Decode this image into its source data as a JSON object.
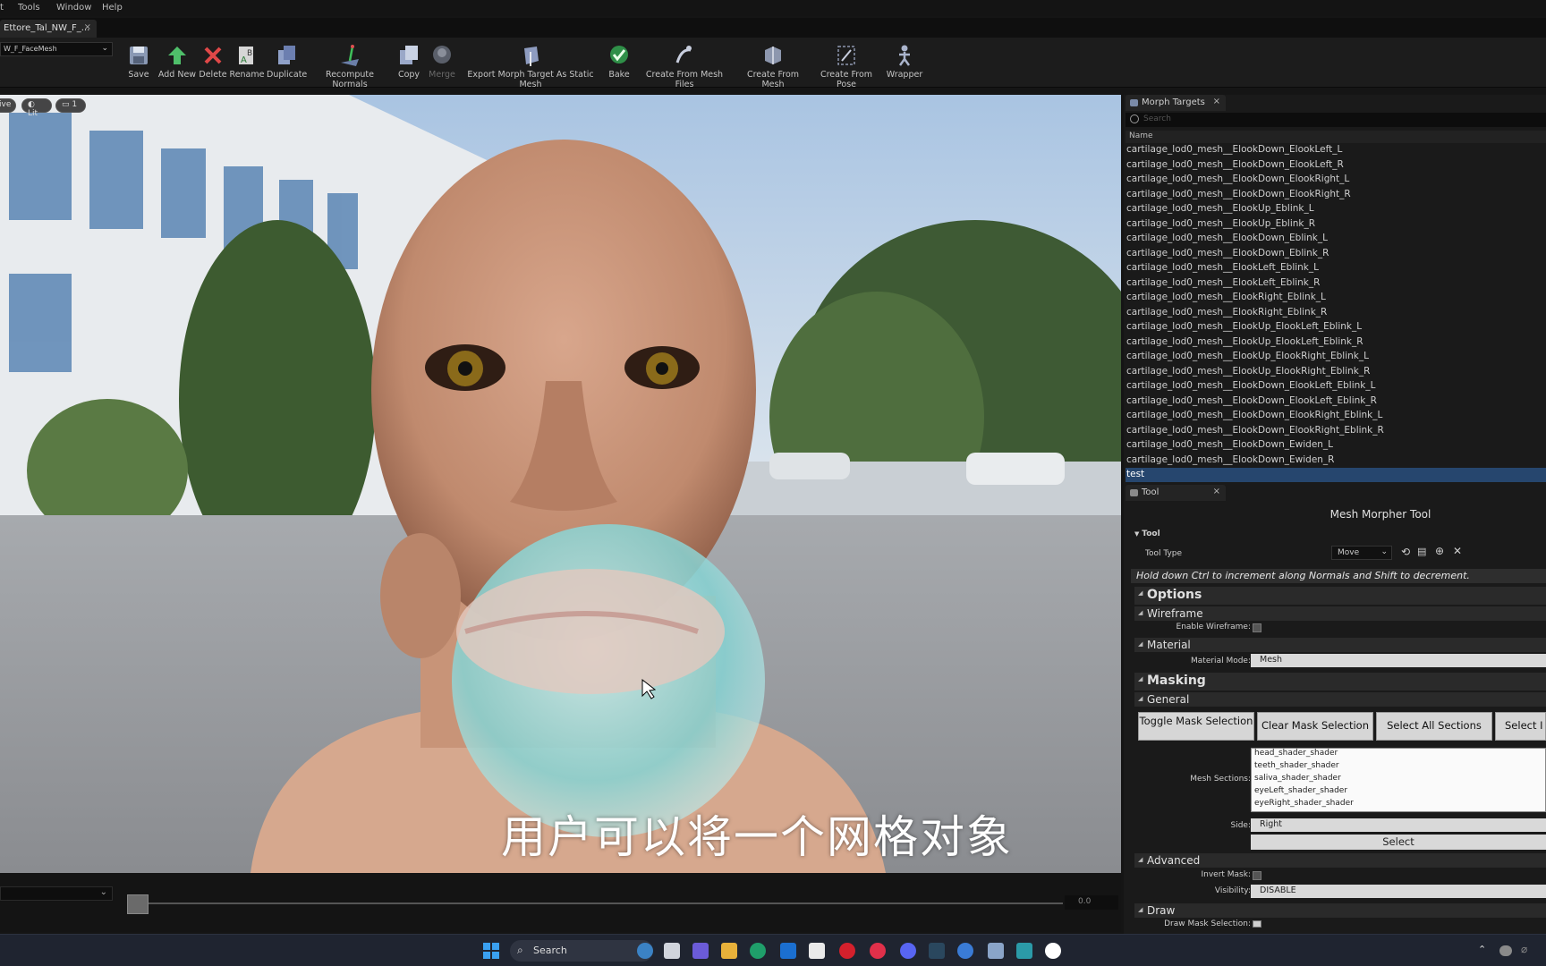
{
  "menu": {
    "items": [
      "t",
      "Tools",
      "Window",
      "Help"
    ]
  },
  "document_tab": {
    "label": "Ettore_Tal_NW_F_...",
    "close": "×"
  },
  "asset_selector": {
    "value": "W_F_FaceMesh"
  },
  "toolbar": {
    "buttons": [
      {
        "label": "Save",
        "icon": "save-icon"
      },
      {
        "label": "Add New",
        "icon": "add-new-icon"
      },
      {
        "label": "Delete",
        "icon": "delete-icon"
      },
      {
        "label": "Rename",
        "icon": "rename-icon"
      },
      {
        "label": "Duplicate",
        "icon": "duplicate-icon"
      },
      {
        "label": "Recompute Normals",
        "icon": "recompute-normals-icon"
      },
      {
        "label": "Copy",
        "icon": "copy-icon"
      },
      {
        "label": "Merge",
        "icon": "merge-icon",
        "disabled": true
      },
      {
        "label": "Export Morph Target As Static Mesh",
        "icon": "export-icon"
      },
      {
        "label": "Bake",
        "icon": "bake-icon"
      },
      {
        "label": "Create From Mesh Files",
        "icon": "create-from-files-icon"
      },
      {
        "label": "Create From Mesh",
        "icon": "create-from-mesh-icon"
      },
      {
        "label": "Create From Pose",
        "icon": "create-from-pose-icon"
      },
      {
        "label": "Wrapper",
        "icon": "wrapper-icon"
      }
    ]
  },
  "viewport": {
    "pills": {
      "mode": "ive",
      "lit": "Lit",
      "camera": "1"
    },
    "subtitle": "用户可以将一个网格对象"
  },
  "timeline": {
    "value": "0.0"
  },
  "morph_targets": {
    "tab_label": "Morph Targets",
    "close": "×",
    "search_placeholder": "Search",
    "column_header": "Name",
    "items": [
      "cartilage_lod0_mesh__ElookDown_ElookLeft_L",
      "cartilage_lod0_mesh__ElookDown_ElookLeft_R",
      "cartilage_lod0_mesh__ElookDown_ElookRight_L",
      "cartilage_lod0_mesh__ElookDown_ElookRight_R",
      "cartilage_lod0_mesh__ElookUp_Eblink_L",
      "cartilage_lod0_mesh__ElookUp_Eblink_R",
      "cartilage_lod0_mesh__ElookDown_Eblink_L",
      "cartilage_lod0_mesh__ElookDown_Eblink_R",
      "cartilage_lod0_mesh__ElookLeft_Eblink_L",
      "cartilage_lod0_mesh__ElookLeft_Eblink_R",
      "cartilage_lod0_mesh__ElookRight_Eblink_L",
      "cartilage_lod0_mesh__ElookRight_Eblink_R",
      "cartilage_lod0_mesh__ElookUp_ElookLeft_Eblink_L",
      "cartilage_lod0_mesh__ElookUp_ElookLeft_Eblink_R",
      "cartilage_lod0_mesh__ElookUp_ElookRight_Eblink_L",
      "cartilage_lod0_mesh__ElookUp_ElookRight_Eblink_R",
      "cartilage_lod0_mesh__ElookDown_ElookLeft_Eblink_L",
      "cartilage_lod0_mesh__ElookDown_ElookLeft_Eblink_R",
      "cartilage_lod0_mesh__ElookDown_ElookRight_Eblink_L",
      "cartilage_lod0_mesh__ElookDown_ElookRight_Eblink_R",
      "cartilage_lod0_mesh__ElookDown_Ewiden_L",
      "cartilage_lod0_mesh__ElookDown_Ewiden_R",
      "test"
    ],
    "selected": "test"
  },
  "tool_panel": {
    "tab_label": "Tool",
    "close": "×",
    "title": "Mesh Morpher Tool",
    "category": "Tool",
    "tool_type_label": "Tool Type",
    "tool_type_value": "Move",
    "hint": "Hold down Ctrl to increment along Normals and Shift to decrement.",
    "options_header": "Options",
    "wireframe_header": "Wireframe",
    "enable_wireframe_label": "Enable Wireframe:",
    "material_header": "Material",
    "material_mode_label": "Material Mode:",
    "material_mode_value": "Mesh",
    "masking_header": "Masking",
    "general_header": "General",
    "mask_buttons": [
      "Toggle Mask Selection",
      "Clear Mask Selection",
      "Select All Sections",
      "Select I"
    ],
    "mesh_sections_label": "Mesh Sections:",
    "mesh_sections": [
      "head_shader_shader",
      "teeth_shader_shader",
      "saliva_shader_shader",
      "eyeLeft_shader_shader",
      "eyeRight_shader_shader"
    ],
    "side_label": "Side:",
    "side_value": "Right",
    "select_label": "Select",
    "advanced_header": "Advanced",
    "invert_mask_label": "Invert Mask:",
    "visibility_label": "Visibility:",
    "visibility_value": "DISABLE",
    "draw_header": "Draw",
    "draw_mask_label": "Draw Mask Selection:"
  },
  "taskbar": {
    "search_label": "Search"
  },
  "colors": {
    "selection": "#26466e",
    "panel_bg": "#1a1a1a",
    "accent_blue": "#2f6fd6"
  }
}
